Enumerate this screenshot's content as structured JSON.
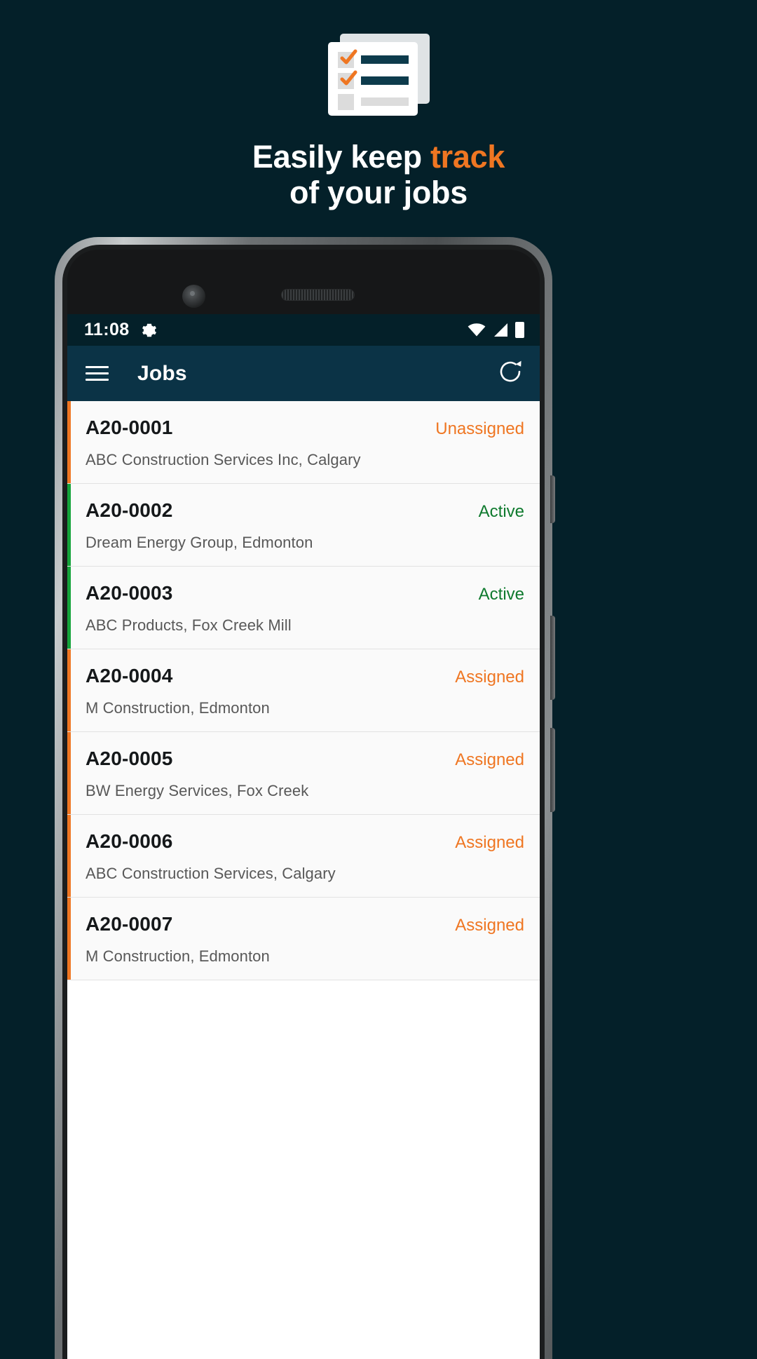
{
  "promo": {
    "background_color": "#042029",
    "accent_color": "#ef7622",
    "headline_line1_plain": "Easily keep ",
    "headline_line1_accent": "track",
    "headline_line2": "of your jobs",
    "illustration": "checklist-icon"
  },
  "phone": {
    "status_bar": {
      "time": "11:08",
      "settings_icon": "gear-icon",
      "wifi_icon": "wifi-icon",
      "signal_icon": "cell-signal-icon",
      "battery_icon": "battery-full-icon",
      "background_color": "#042029"
    },
    "app_bar": {
      "menu_icon": "hamburger-menu-icon",
      "title": "Jobs",
      "refresh_icon": "refresh-icon",
      "background_color": "#0b3346"
    }
  },
  "jobs": {
    "status_colors": {
      "Unassigned": "#ef7622",
      "Assigned": "#ef7622",
      "Active": "#0f7a2e"
    },
    "accent_colors": {
      "Unassigned": "#ef7622",
      "Assigned": "#ef7622",
      "Active": "#14a33a"
    },
    "rows": [
      {
        "id": "A20-0001",
        "status": "Unassigned",
        "customer": "ABC Construction Services Inc, Calgary"
      },
      {
        "id": "A20-0002",
        "status": "Active",
        "customer": "Dream Energy Group, Edmonton"
      },
      {
        "id": "A20-0003",
        "status": "Active",
        "customer": "ABC Products, Fox Creek Mill"
      },
      {
        "id": "A20-0004",
        "status": "Assigned",
        "customer": "M Construction, Edmonton"
      },
      {
        "id": "A20-0005",
        "status": "Assigned",
        "customer": "BW Energy Services, Fox Creek"
      },
      {
        "id": "A20-0006",
        "status": "Assigned",
        "customer": "ABC Construction Services, Calgary"
      },
      {
        "id": "A20-0007",
        "status": "Assigned",
        "customer": "M Construction, Edmonton"
      }
    ]
  }
}
